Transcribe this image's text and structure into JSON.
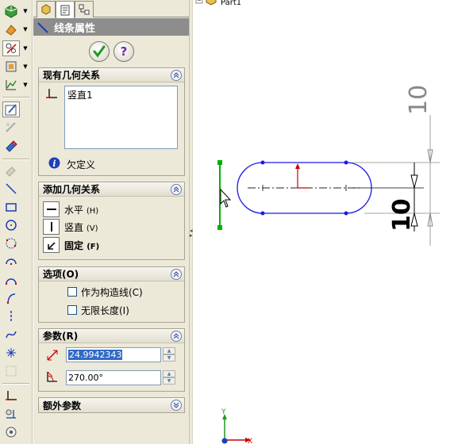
{
  "tree": {
    "root_label": "Part1"
  },
  "panel": {
    "title": "线条属性",
    "ok_label": "OK",
    "help_label": "?"
  },
  "existing_relations": {
    "header": "现有几何关系",
    "items": [
      "竖直1"
    ],
    "status": "欠定义"
  },
  "add_relations": {
    "header": "添加几何关系",
    "items": [
      {
        "label": "水平",
        "shortcut": "(H)"
      },
      {
        "label": "竖直",
        "shortcut": "(V)"
      },
      {
        "label": "固定",
        "shortcut": "(F)"
      }
    ]
  },
  "options": {
    "header": "选项(O)",
    "checkboxes": [
      {
        "label": "作为构造线(C)",
        "checked": false
      },
      {
        "label": "无限长度(I)",
        "checked": false
      }
    ]
  },
  "parameters": {
    "header": "参数(R)",
    "length_value": "24.9942343",
    "angle_value": "270.00°"
  },
  "extra_parameters": {
    "header": "额外参数"
  },
  "dimensions": {
    "upper": "10",
    "lower": "10"
  },
  "axes": {
    "y": "Y",
    "x": "X"
  },
  "colors": {
    "accent_green": "#00a000",
    "sketch_blue": "#1a1ae6",
    "selection_green": "#00b000",
    "panel_bg": "#ece9d8",
    "header_gray": "#8d8d8d",
    "origin_red": "#cc0000"
  }
}
